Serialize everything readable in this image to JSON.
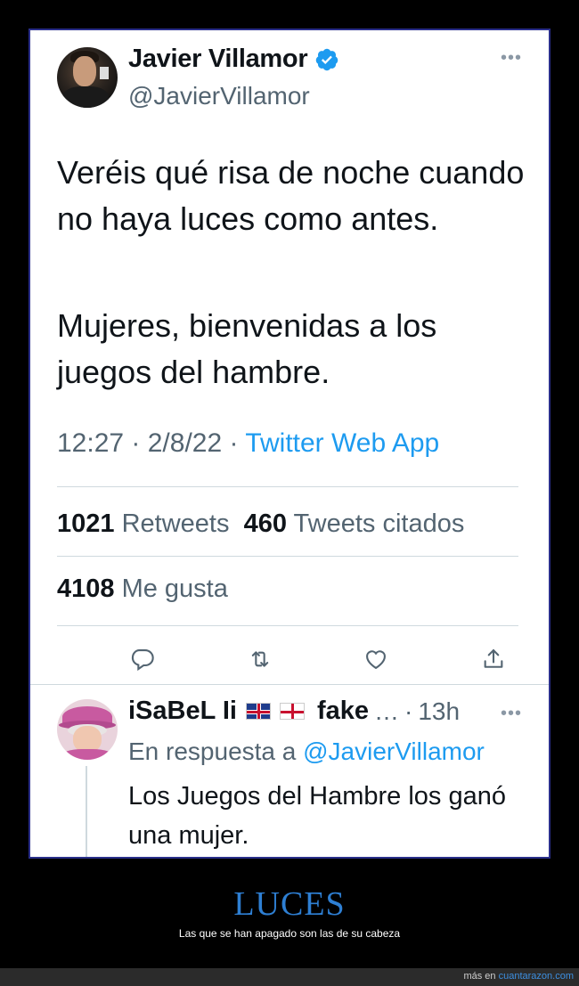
{
  "tweet": {
    "author_name": "Javier Villamor",
    "author_handle": "@JavierVillamor",
    "paragraphs": [
      "Veréis qué risa de noche cuando no haya luces como antes.",
      "Mujeres, bienvenidas a los juegos del hambre."
    ],
    "time": "12:27",
    "date": "2/8/22",
    "source": "Twitter Web App",
    "retweets_count": "1021",
    "retweets_label": "Retweets",
    "quotes_count": "460",
    "quotes_label": "Tweets citados",
    "likes_count": "4108",
    "likes_label": "Me gusta",
    "more_icon": "more-horizontal-icon"
  },
  "actions": [
    {
      "name": "reply-icon"
    },
    {
      "name": "retweet-icon"
    },
    {
      "name": "like-icon"
    },
    {
      "name": "share-icon"
    }
  ],
  "reply": {
    "author_name": "iSaBeL Ii",
    "fake": "fake",
    "ellipsis": "…",
    "time": "13h",
    "reply_prefix": "En respuesta a",
    "reply_mention": "@JavierVillamor",
    "text": "Los Juegos del Hambre los ganó una mujer."
  },
  "caption": {
    "title": "LUCES",
    "subtitle": "Las que se han apagado son las de su cabeza"
  },
  "footer": {
    "prefix": "más en",
    "site": "cuantarazon.com"
  },
  "colors": {
    "accent": "#1d9bf0",
    "text": "#0f1419",
    "secondary": "#536471",
    "caption_title": "#2e7fd3"
  }
}
